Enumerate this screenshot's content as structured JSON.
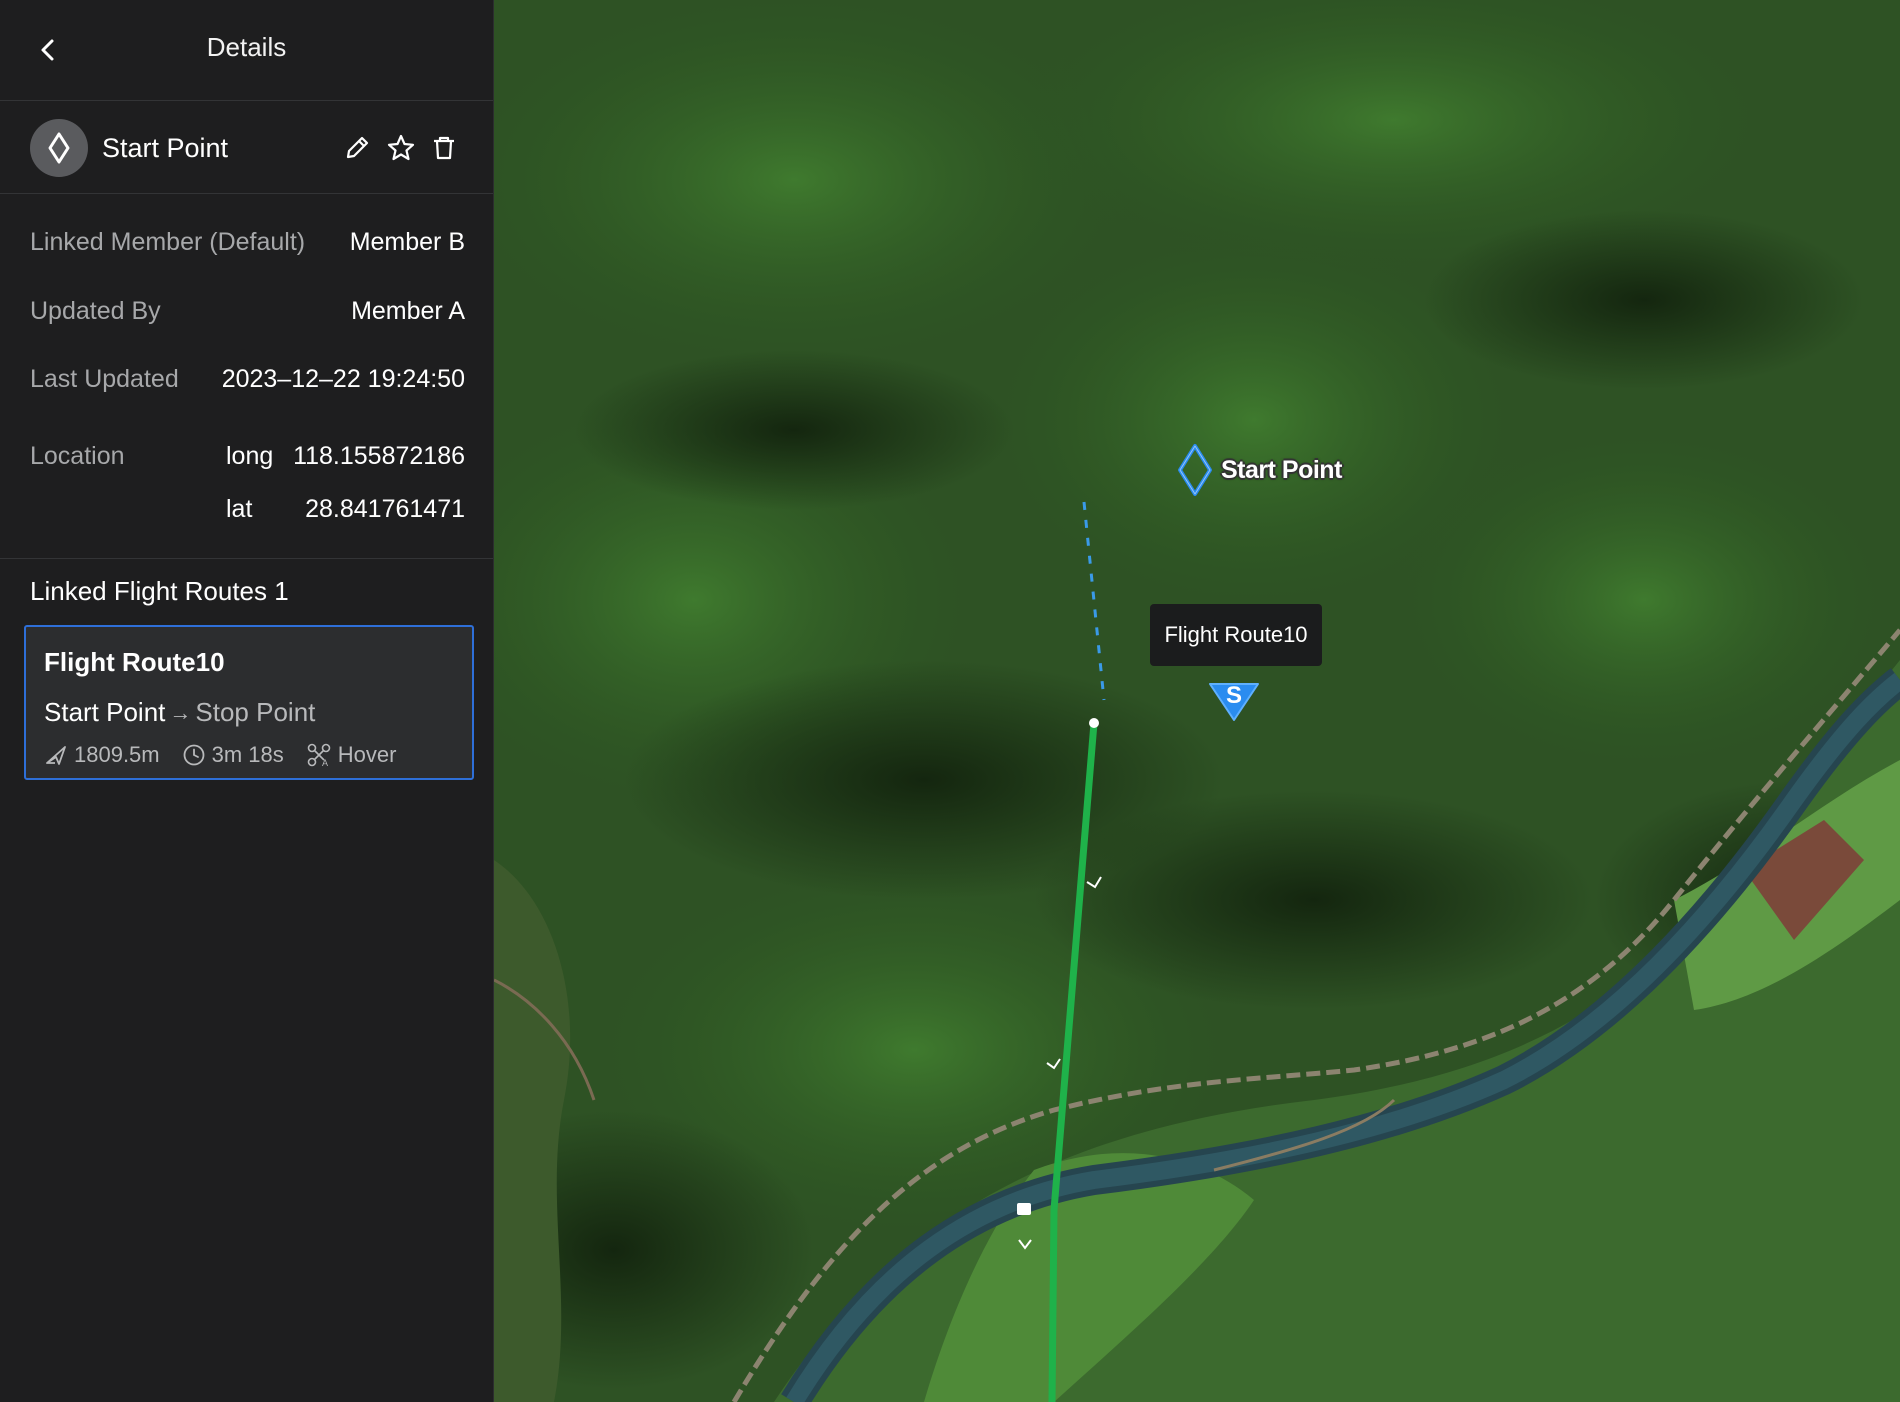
{
  "header": {
    "title": "Details",
    "back_icon": "chevron-left-icon"
  },
  "point": {
    "name": "Start Point",
    "icon": "diamond-waypoint-icon",
    "actions": [
      "pencil-icon",
      "star-icon",
      "trash-icon"
    ]
  },
  "info": {
    "linked_member_label": "Linked Member (Default)",
    "linked_member_value": "Member B",
    "updated_by_label": "Updated By",
    "updated_by_value": "Member A",
    "last_updated_label": "Last Updated",
    "last_updated_value": "2023–12–22 19:24:50",
    "location_label": "Location",
    "long_label": "long",
    "long_value": "118.155872186",
    "lat_label": "lat",
    "lat_value": "28.841761471"
  },
  "linked_routes": {
    "title": "Linked Flight Routes 1",
    "routes": [
      {
        "name": "Flight Route10",
        "from": "Start Point",
        "to": "Stop Point",
        "distance": "1809.5m",
        "duration": "3m 18s",
        "finish_action": "Hover"
      }
    ]
  },
  "map": {
    "start_label": "Start Point",
    "route_tooltip": "Flight Route10",
    "start_marker_letter": "S",
    "colors": {
      "route": "#1fb24a",
      "marker": "#2a8cf0",
      "river": "#2a4e5a"
    }
  }
}
